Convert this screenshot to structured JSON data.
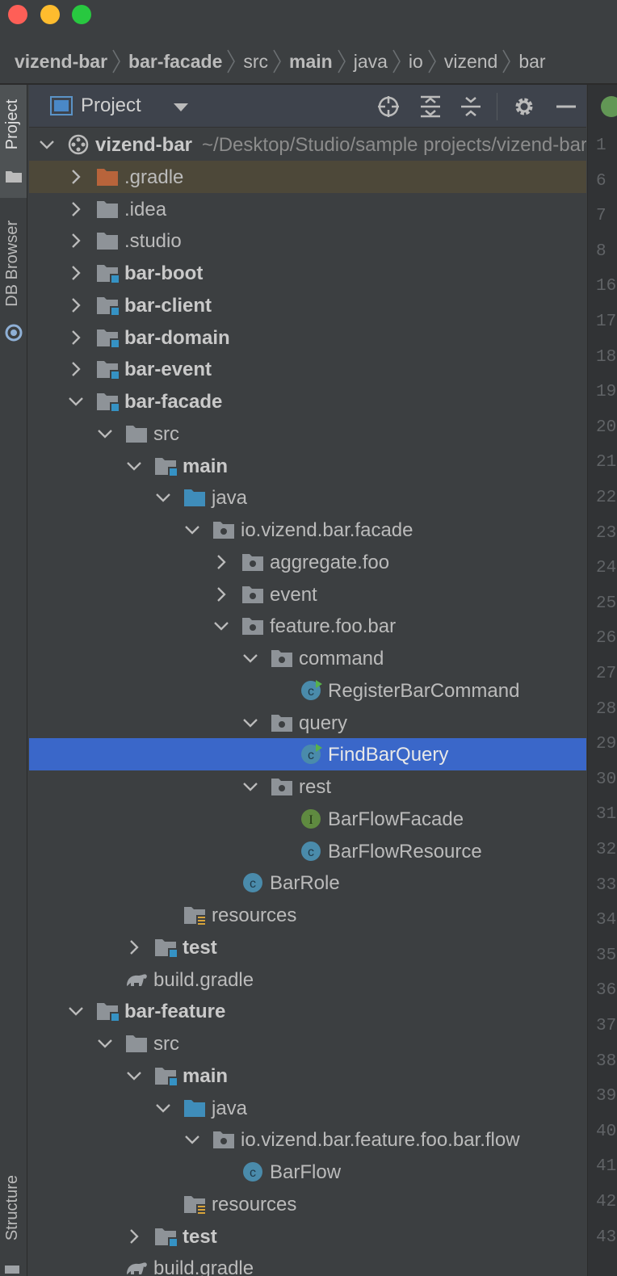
{
  "breadcrumb": [
    {
      "label": "vizend-bar",
      "bold": true
    },
    {
      "label": "bar-facade",
      "bold": true
    },
    {
      "label": "src",
      "bold": false
    },
    {
      "label": "main",
      "bold": true
    },
    {
      "label": "java",
      "bold": false
    },
    {
      "label": "io",
      "bold": false
    },
    {
      "label": "vizend",
      "bold": false
    },
    {
      "label": "bar",
      "bold": false
    }
  ],
  "tool_stripe": {
    "project_label": "Project",
    "db_browser_label": "DB Browser",
    "structure_label": "Structure"
  },
  "panel": {
    "title": "Project",
    "icons": [
      "locate-icon",
      "expand-all-icon",
      "collapse-all-icon",
      "gear-icon",
      "hide-icon"
    ]
  },
  "tree": [
    {
      "label": "vizend-bar",
      "suffix": "~/Desktop/Studio/sample projects/vizend-bar",
      "depth": 0,
      "expanded": true,
      "icon": "project-icon",
      "bold": true
    },
    {
      "label": ".gradle",
      "depth": 1,
      "expanded": false,
      "icon": "folder-excluded-icon",
      "bold": false,
      "highlight": true
    },
    {
      "label": ".idea",
      "depth": 1,
      "expanded": false,
      "icon": "folder-icon",
      "bold": false
    },
    {
      "label": ".studio",
      "depth": 1,
      "expanded": false,
      "icon": "folder-icon",
      "bold": false
    },
    {
      "label": "bar-boot",
      "depth": 1,
      "expanded": false,
      "icon": "module-icon",
      "bold": true
    },
    {
      "label": "bar-client",
      "depth": 1,
      "expanded": false,
      "icon": "module-icon",
      "bold": true
    },
    {
      "label": "bar-domain",
      "depth": 1,
      "expanded": false,
      "icon": "module-icon",
      "bold": true
    },
    {
      "label": "bar-event",
      "depth": 1,
      "expanded": false,
      "icon": "module-icon",
      "bold": true
    },
    {
      "label": "bar-facade",
      "depth": 1,
      "expanded": true,
      "icon": "module-icon",
      "bold": true
    },
    {
      "label": "src",
      "depth": 2,
      "expanded": true,
      "icon": "folder-icon",
      "bold": false
    },
    {
      "label": "main",
      "depth": 3,
      "expanded": true,
      "icon": "module-icon",
      "bold": true
    },
    {
      "label": "java",
      "depth": 4,
      "expanded": true,
      "icon": "source-folder-icon",
      "bold": false
    },
    {
      "label": "io.vizend.bar.facade",
      "depth": 5,
      "expanded": true,
      "icon": "package-icon",
      "bold": false
    },
    {
      "label": "aggregate.foo",
      "depth": 6,
      "expanded": false,
      "icon": "package-icon",
      "bold": false
    },
    {
      "label": "event",
      "depth": 6,
      "expanded": false,
      "icon": "package-icon",
      "bold": false
    },
    {
      "label": "feature.foo.bar",
      "depth": 6,
      "expanded": true,
      "icon": "package-icon",
      "bold": false
    },
    {
      "label": "command",
      "depth": 7,
      "expanded": true,
      "icon": "package-icon",
      "bold": false
    },
    {
      "label": "RegisterBarCommand",
      "depth": 8,
      "icon": "runnable-class-icon",
      "bold": false
    },
    {
      "label": "query",
      "depth": 7,
      "expanded": true,
      "icon": "package-icon",
      "bold": false
    },
    {
      "label": "FindBarQuery",
      "depth": 8,
      "icon": "runnable-class-icon",
      "bold": false,
      "selected": true
    },
    {
      "label": "rest",
      "depth": 7,
      "expanded": true,
      "icon": "package-icon",
      "bold": false
    },
    {
      "label": "BarFlowFacade",
      "depth": 8,
      "icon": "interface-icon",
      "bold": false
    },
    {
      "label": "BarFlowResource",
      "depth": 8,
      "icon": "class-icon",
      "bold": false
    },
    {
      "label": "BarRole",
      "depth": 6,
      "icon": "class-icon",
      "bold": false
    },
    {
      "label": "resources",
      "depth": 4,
      "icon": "resources-folder-icon",
      "bold": false
    },
    {
      "label": "test",
      "depth": 3,
      "expanded": false,
      "icon": "module-icon",
      "bold": true
    },
    {
      "label": "build.gradle",
      "depth": 2,
      "icon": "gradle-icon",
      "bold": false
    },
    {
      "label": "bar-feature",
      "depth": 1,
      "expanded": true,
      "icon": "module-icon",
      "bold": true
    },
    {
      "label": "src",
      "depth": 2,
      "expanded": true,
      "icon": "folder-icon",
      "bold": false
    },
    {
      "label": "main",
      "depth": 3,
      "expanded": true,
      "icon": "module-icon",
      "bold": true
    },
    {
      "label": "java",
      "depth": 4,
      "expanded": true,
      "icon": "source-folder-icon",
      "bold": false
    },
    {
      "label": "io.vizend.bar.feature.foo.bar.flow",
      "depth": 5,
      "expanded": true,
      "icon": "package-icon",
      "bold": false
    },
    {
      "label": "BarFlow",
      "depth": 6,
      "icon": "class-icon",
      "bold": false
    },
    {
      "label": "resources",
      "depth": 4,
      "icon": "resources-folder-icon",
      "bold": false
    },
    {
      "label": "test",
      "depth": 3,
      "expanded": false,
      "icon": "module-icon",
      "bold": true
    },
    {
      "label": "build.gradle",
      "depth": 2,
      "icon": "gradle-icon",
      "bold": false
    }
  ],
  "gutter_line_numbers": [
    "1",
    "6",
    "7",
    "8",
    "16",
    "17",
    "18",
    "19",
    "20",
    "21",
    "22",
    "23",
    "24",
    "25",
    "26",
    "27",
    "28",
    "29",
    "30",
    "31",
    "32",
    "33",
    "34",
    "35",
    "36",
    "37",
    "38",
    "39",
    "40",
    "41",
    "42",
    "43"
  ],
  "colors": {
    "selection": "#3a67c9",
    "highlight": "#4d4839",
    "folder": "#8e9398",
    "module_badge": "#3592c4",
    "class_icon": "#4a8bab",
    "interface_icon": "#5f8a40"
  }
}
